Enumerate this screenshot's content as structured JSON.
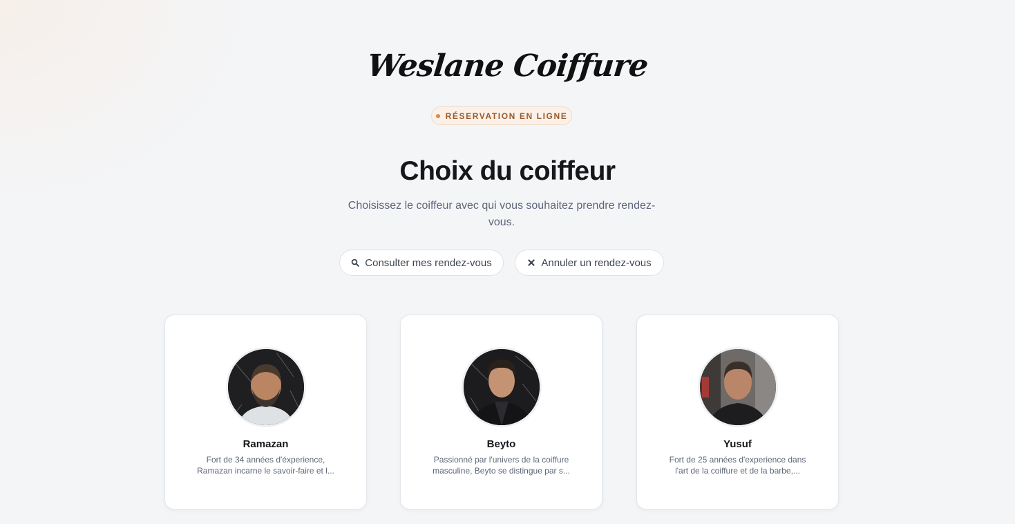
{
  "brand": {
    "logo_text": "Weslane Coiffure"
  },
  "badge": {
    "label": "RÉSERVATION EN LIGNE",
    "color": "#d68c57"
  },
  "header": {
    "title": "Choix du coiffeur",
    "subtitle": "Choisissez le coiffeur avec qui vous souhaitez prendre rendez-vous."
  },
  "actions": {
    "consult": {
      "label": "Consulter mes rendez-vous",
      "icon": "search-icon"
    },
    "cancel": {
      "label": "Annuler un rendez-vous",
      "icon": "close-icon"
    }
  },
  "barbers": [
    {
      "name": "Ramazan",
      "description": "Fort de 34 années d'éxperience, Ramazan incarne le savoir-faire et l...",
      "avatar": "avatar-photo"
    },
    {
      "name": "Beyto",
      "description": "Passionné par l'univers de la coiffure masculine, Beyto se distingue par s...",
      "avatar": "avatar-photo"
    },
    {
      "name": "Yusuf",
      "description": "Fort de 25 années d'experience dans l'art de la coiffure et de la barbe,...",
      "avatar": "avatar-photo"
    }
  ]
}
